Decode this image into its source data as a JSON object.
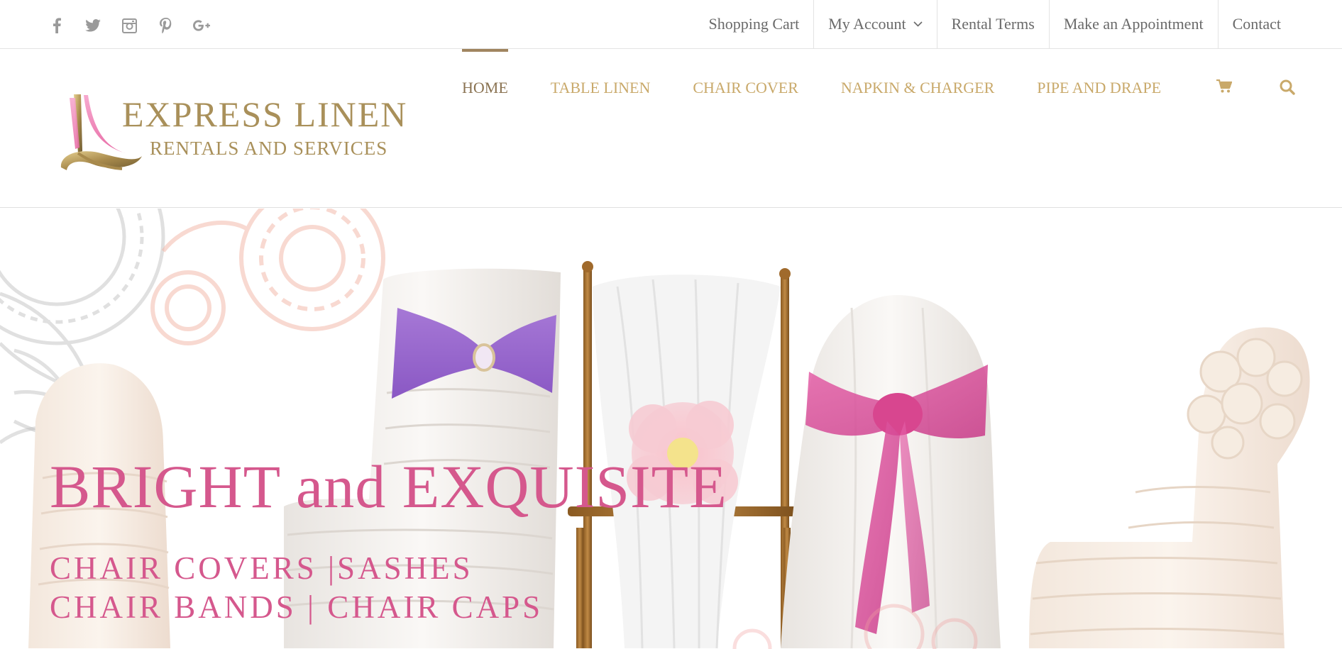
{
  "social": {
    "icons": [
      "facebook-icon",
      "twitter-icon",
      "instagram-icon",
      "pinterest-icon",
      "google-plus-icon"
    ],
    "color": "#9a9a9a"
  },
  "secondary_nav": {
    "items": [
      {
        "label": "Shopping Cart"
      },
      {
        "label": "My Account",
        "has_dropdown": true
      },
      {
        "label": "Rental Terms"
      },
      {
        "label": "Make an Appointment"
      },
      {
        "label": "Contact"
      }
    ]
  },
  "logo": {
    "line1": "EXPRESS LINEN",
    "line2": "RENTALS AND SERVICES",
    "gold": "#a9905a",
    "pink": "#f090c0"
  },
  "main_nav": {
    "items": [
      {
        "label": "HOME",
        "active": true
      },
      {
        "label": "TABLE LINEN"
      },
      {
        "label": "CHAIR COVER"
      },
      {
        "label": "NAPKIN & CHARGER"
      },
      {
        "label": "PIPE AND DRAPE"
      }
    ],
    "icons": [
      "cart-icon",
      "search-icon"
    ],
    "color": "#c9a96a",
    "active_color": "#8a7352"
  },
  "hero": {
    "title": "BRIGHT and EXQUISITE",
    "subtitle_1": "CHAIR COVERS |SASHES",
    "subtitle_2": "CHAIR BANDS | CHAIR CAPS",
    "text_color": "#d5588d"
  }
}
